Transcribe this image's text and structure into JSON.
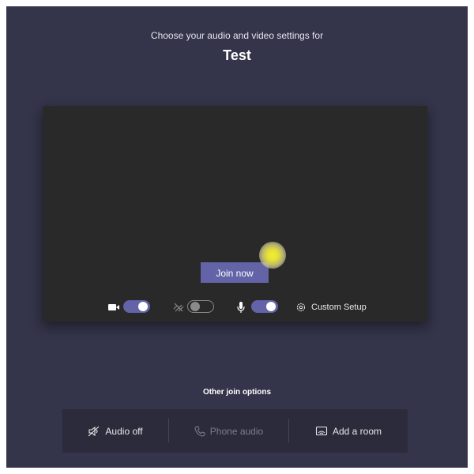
{
  "header": {
    "subtitle": "Choose your audio and video settings for",
    "meeting_title": "Test"
  },
  "preview": {
    "join_button_label": "Join now",
    "controls": {
      "camera": {
        "icon": "camera-icon",
        "enabled": true
      },
      "background_blur": {
        "icon": "blur-icon",
        "enabled": false
      },
      "microphone": {
        "icon": "microphone-icon",
        "enabled": true
      },
      "custom_setup": {
        "icon": "gear-icon",
        "label": "Custom Setup"
      }
    }
  },
  "other_join_options": {
    "heading": "Other join options",
    "options": [
      {
        "label": "Audio off",
        "icon": "speaker-off-icon",
        "disabled": false
      },
      {
        "label": "Phone audio",
        "icon": "phone-icon",
        "disabled": true
      },
      {
        "label": "Add a room",
        "icon": "cast-icon",
        "disabled": false
      }
    ]
  },
  "colors": {
    "background": "#34344a",
    "preview_background": "#292929",
    "accent": "#6264a7",
    "panel_background": "#2b2b3c"
  }
}
